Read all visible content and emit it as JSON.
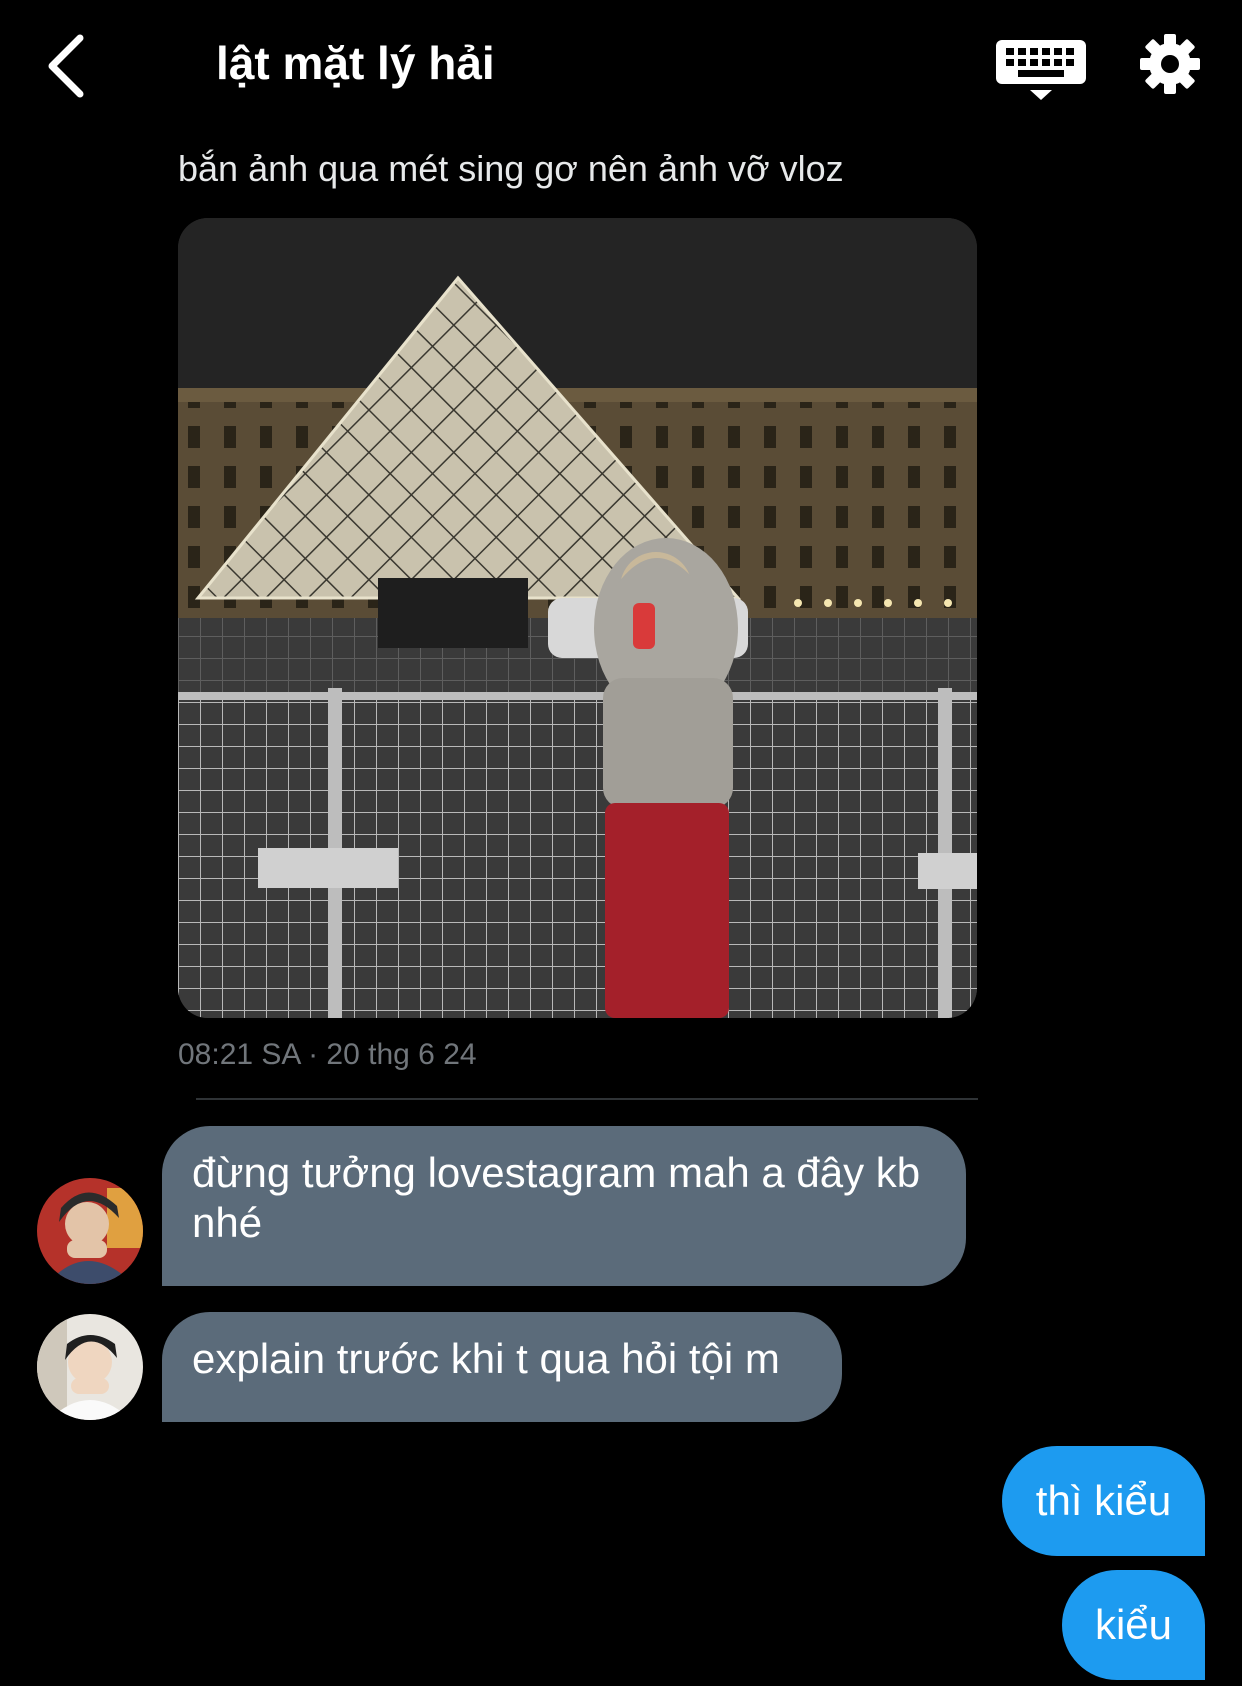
{
  "header": {
    "title": "lật mặt lý hải",
    "back_icon": "chevron-left-icon",
    "keyboard_icon": "keyboard-icon",
    "settings_icon": "gear-icon"
  },
  "shared_post": {
    "caption": "bắn ảnh qua mét sing gơ nên ảnh vỡ vloz",
    "timestamp": "08:21 SA · 20 thg 6 24"
  },
  "messages": [
    {
      "direction": "incoming",
      "text": "đừng tưởng lovestagram mah a đây kb nhé"
    },
    {
      "direction": "incoming",
      "text": "explain trước khi t qua hỏi tội m"
    },
    {
      "direction": "outgoing",
      "text": "thì kiểu"
    },
    {
      "direction": "outgoing",
      "text": "kiểu"
    }
  ],
  "colors": {
    "background": "#000000",
    "incoming_bubble": "#5b6b7a",
    "outgoing_bubble": "#1d9bf0",
    "timestamp": "#71767b"
  }
}
